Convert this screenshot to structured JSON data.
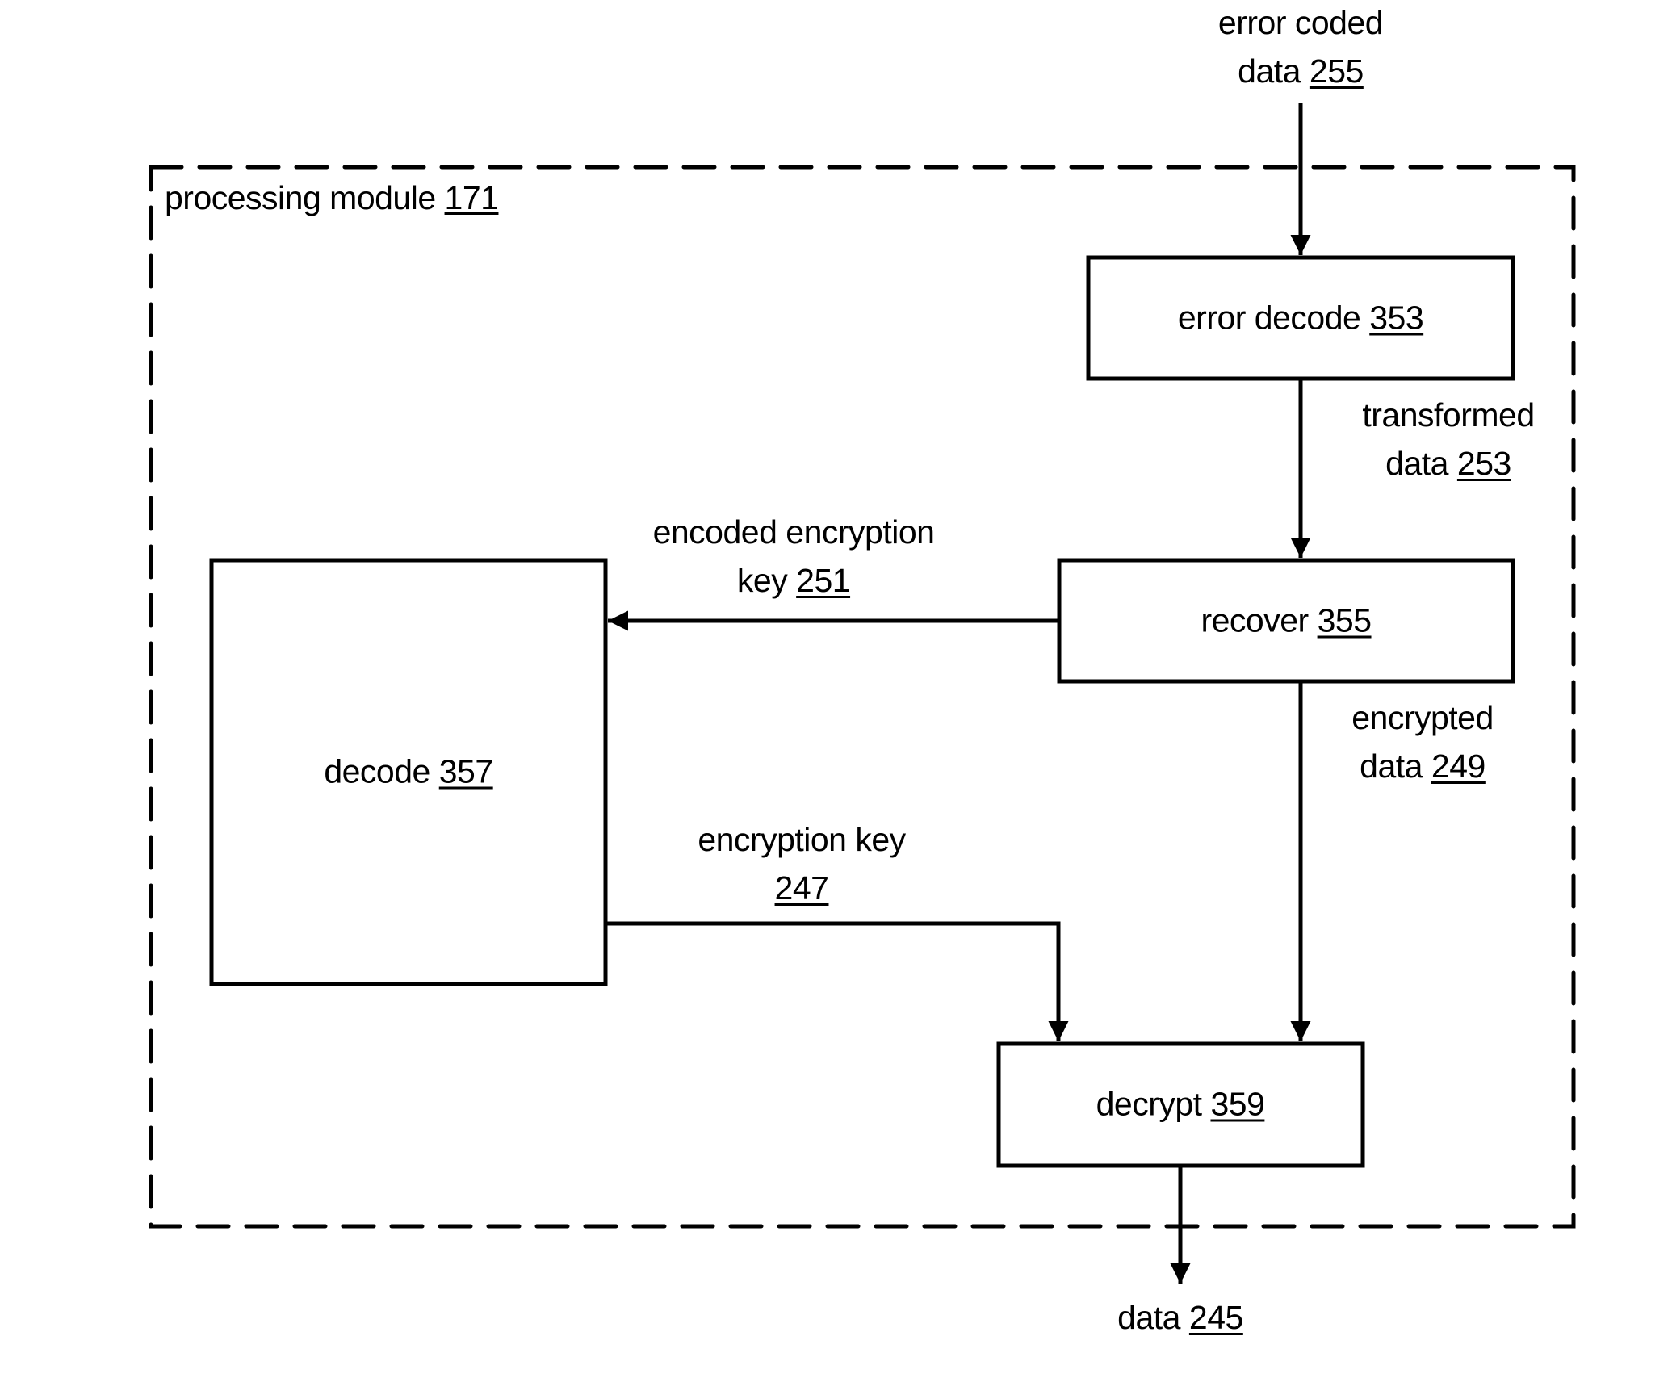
{
  "container": {
    "label": "processing module",
    "ref": "171"
  },
  "blocks": {
    "error_decode": {
      "label": "error decode",
      "ref": "353"
    },
    "recover": {
      "label": "recover",
      "ref": "355"
    },
    "decode": {
      "label": "decode",
      "ref": "357"
    },
    "decrypt": {
      "label": "decrypt",
      "ref": "359"
    }
  },
  "signals": {
    "error_coded_data": {
      "line1": "error coded",
      "line2": "data",
      "ref": "255"
    },
    "transformed_data": {
      "line1": "transformed",
      "line2": "data",
      "ref": "253"
    },
    "encoded_encryption_key": {
      "line1": "encoded encryption",
      "line2": "key",
      "ref": "251"
    },
    "encrypted_data": {
      "line1": "encrypted",
      "line2": "data",
      "ref": "249"
    },
    "encryption_key": {
      "line1": "encryption key",
      "line2": "",
      "ref": "247"
    },
    "data_out": {
      "line1": "data",
      "ref": "245"
    }
  }
}
